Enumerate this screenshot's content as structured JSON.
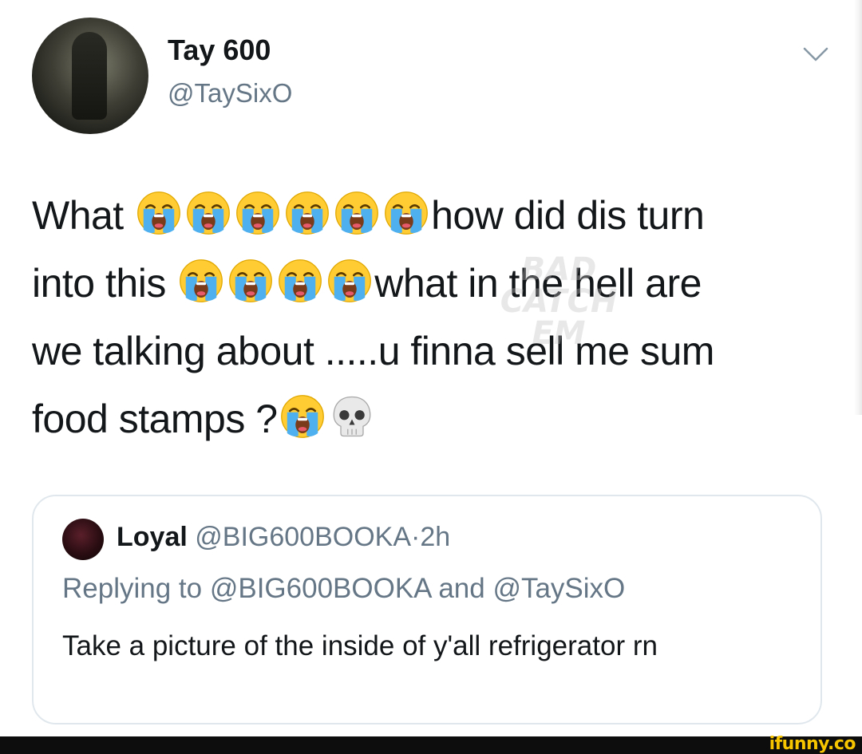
{
  "author": {
    "display_name": "Tay 600",
    "handle": "@TaySixO"
  },
  "tweet": {
    "line1_a": "What",
    "line1_b": "how did dis turn",
    "line2_a": "into this",
    "line2_b": "what in the hell are",
    "line3": "we talking about .....u finna sell me sum",
    "line4": "food stamps ?"
  },
  "icons": {
    "crying_face": "loudly-crying-face-icon",
    "skull": "skull-icon",
    "caret": "chevron-down-icon"
  },
  "watermark": {
    "line1": "BAD",
    "line2": "CATCH",
    "line3": "EM"
  },
  "quoted": {
    "name": "Loyal",
    "handle": "@BIG600BOOKA",
    "separator": "·",
    "time": "2h",
    "replying_to": "Replying to @BIG600BOOKA and @TaySixO",
    "text": "Take a picture of the inside of y'all refrigerator rn"
  },
  "footer": {
    "brand": "ifunny.co"
  },
  "colors": {
    "text_primary": "#14171a",
    "text_secondary": "#657786",
    "card_border": "#e1e8ed",
    "brand_yellow": "#f7c500"
  }
}
